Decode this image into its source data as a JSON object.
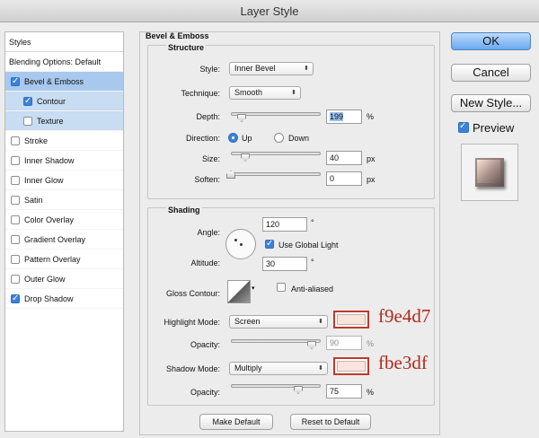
{
  "window": {
    "title": "Layer Style"
  },
  "left_panel": {
    "header": "Styles",
    "items": [
      {
        "label": "Blending Options: Default",
        "checkbox": false,
        "checked": false,
        "selected": false,
        "indent": 0
      },
      {
        "label": "Bevel & Emboss",
        "checkbox": true,
        "checked": true,
        "selected": true,
        "indent": 0
      },
      {
        "label": "Contour",
        "checkbox": true,
        "checked": true,
        "selected": true,
        "indent": 1
      },
      {
        "label": "Texture",
        "checkbox": true,
        "checked": false,
        "selected": true,
        "indent": 1
      },
      {
        "label": "Stroke",
        "checkbox": true,
        "checked": false,
        "selected": false,
        "indent": 0
      },
      {
        "label": "Inner Shadow",
        "checkbox": true,
        "checked": false,
        "selected": false,
        "indent": 0
      },
      {
        "label": "Inner Glow",
        "checkbox": true,
        "checked": false,
        "selected": false,
        "indent": 0
      },
      {
        "label": "Satin",
        "checkbox": true,
        "checked": false,
        "selected": false,
        "indent": 0
      },
      {
        "label": "Color Overlay",
        "checkbox": true,
        "checked": false,
        "selected": false,
        "indent": 0
      },
      {
        "label": "Gradient Overlay",
        "checkbox": true,
        "checked": false,
        "selected": false,
        "indent": 0
      },
      {
        "label": "Pattern Overlay",
        "checkbox": true,
        "checked": false,
        "selected": false,
        "indent": 0
      },
      {
        "label": "Outer Glow",
        "checkbox": true,
        "checked": false,
        "selected": false,
        "indent": 0
      },
      {
        "label": "Drop Shadow",
        "checkbox": true,
        "checked": true,
        "selected": false,
        "indent": 0
      }
    ]
  },
  "bevel": {
    "title": "Bevel & Emboss",
    "structure": {
      "title": "Structure",
      "style_label": "Style:",
      "style_value": "Inner Bevel",
      "technique_label": "Technique:",
      "technique_value": "Smooth",
      "depth_label": "Depth:",
      "depth_value": "199",
      "depth_unit": "%",
      "depth_slider": 0.12,
      "direction_label": "Direction:",
      "direction_up": "Up",
      "direction_down": "Down",
      "direction_selected": "Up",
      "size_label": "Size:",
      "size_value": "40",
      "size_unit": "px",
      "size_slider": 0.16,
      "soften_label": "Soften:",
      "soften_value": "0",
      "soften_unit": "px",
      "soften_slider": 0
    },
    "shading": {
      "title": "Shading",
      "angle_label": "Angle:",
      "angle_value": "120",
      "angle_unit": "°",
      "use_global_light_label": "Use Global Light",
      "use_global_light": true,
      "altitude_label": "Altitude:",
      "altitude_value": "30",
      "altitude_unit": "°",
      "gloss_contour_label": "Gloss Contour:",
      "anti_aliased_label": "Anti-aliased",
      "anti_aliased": false,
      "highlight_mode_label": "Highlight Mode:",
      "highlight_mode_value": "Screen",
      "highlight_color": "#f9e4d7",
      "highlight_annotation": "f9e4d7",
      "highlight_opacity_label": "Opacity:",
      "highlight_opacity_value": "90",
      "highlight_opacity_unit": "%",
      "highlight_opacity_slider": 0.9,
      "shadow_mode_label": "Shadow Mode:",
      "shadow_mode_value": "Multiply",
      "shadow_color": "#fbe3df",
      "shadow_annotation": "fbe3df",
      "shadow_opacity_label": "Opacity:",
      "shadow_opacity_value": "75",
      "shadow_opacity_unit": "%",
      "shadow_opacity_slider": 0.75
    },
    "make_default": "Make Default",
    "reset_default": "Reset to Default"
  },
  "right_panel": {
    "ok": "OK",
    "cancel": "Cancel",
    "new_style": "New Style...",
    "preview_label": "Preview",
    "preview_checked": true
  },
  "colors": {
    "accent": "#3b82d8",
    "annotation": "#b02a1d",
    "annotation_box": "#c0392b"
  }
}
